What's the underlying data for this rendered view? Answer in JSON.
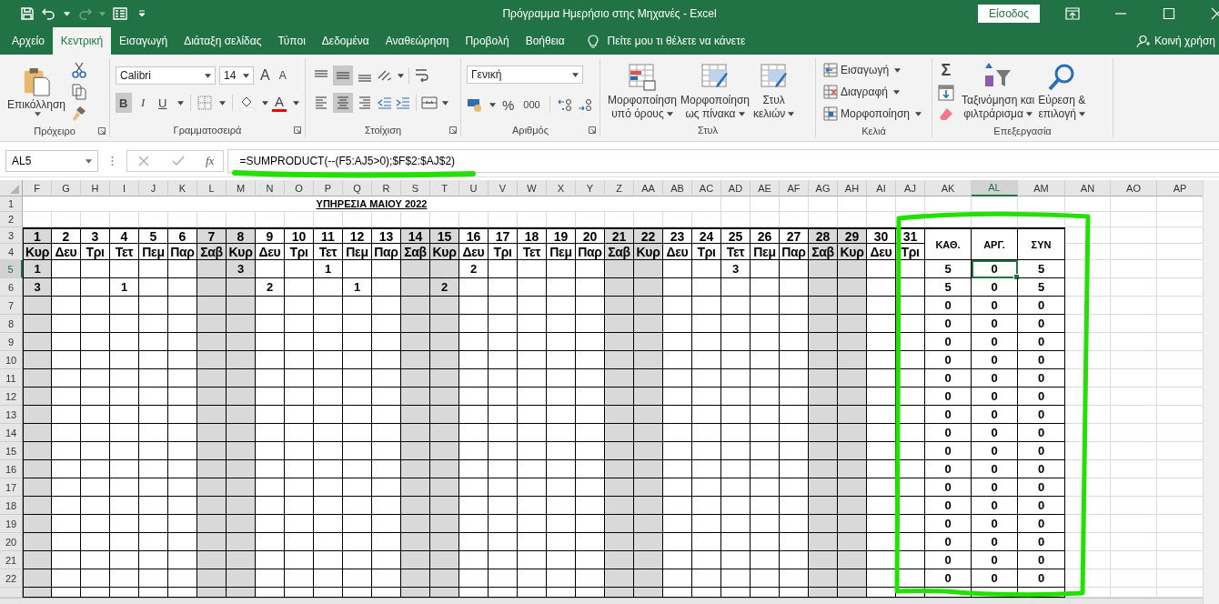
{
  "window": {
    "title": "Πρόγραμμα Ημερήσιο στης Μηχανές  -  Excel",
    "sign_in": "Είσοδος"
  },
  "tabs": [
    {
      "label": "Αρχείο",
      "selected": false
    },
    {
      "label": "Κεντρική",
      "selected": true
    },
    {
      "label": "Εισαγωγή",
      "selected": false
    },
    {
      "label": "Διάταξη σελίδας",
      "selected": false
    },
    {
      "label": "Τύποι",
      "selected": false
    },
    {
      "label": "Δεδομένα",
      "selected": false
    },
    {
      "label": "Αναθεώρηση",
      "selected": false
    },
    {
      "label": "Προβολή",
      "selected": false
    },
    {
      "label": "Βοήθεια",
      "selected": false
    }
  ],
  "tell_me": "Πείτε μου τι θέλετε να κάνετε",
  "share": "Κοινή χρήση",
  "ribbon": {
    "clipboard": {
      "paste": "Επικόλληση",
      "label": "Πρόχειρο"
    },
    "font": {
      "name": "Calibri",
      "size": "14",
      "grow": "A",
      "shrink": "A",
      "color_letter": "A",
      "label": "Γραμματοσειρά",
      "styles": [
        {
          "kind": "bold",
          "label": "B",
          "on": true
        },
        {
          "kind": "italic",
          "label": "I",
          "on": false
        },
        {
          "kind": "underline",
          "label": "U",
          "on": false
        }
      ]
    },
    "alignment": {
      "label": "Στοίχιση",
      "vertical": [
        {
          "kind": "top",
          "selected": false
        },
        {
          "kind": "middle",
          "selected": true
        },
        {
          "kind": "bottom",
          "selected": false
        }
      ],
      "horizontal": [
        {
          "kind": "left",
          "selected": false
        },
        {
          "kind": "center",
          "selected": true
        },
        {
          "kind": "right",
          "selected": false
        }
      ]
    },
    "number": {
      "format": "Γενική",
      "percent": "%",
      "thousands": "000",
      "label": "Αριθμός"
    },
    "styles": {
      "label": "Στυλ",
      "buttons": [
        {
          "lines": [
            "Μορφοποίηση",
            "υπό όρους"
          ]
        },
        {
          "lines": [
            "Μορφοποίηση",
            "ως πίνακα"
          ]
        },
        {
          "lines": [
            "Στυλ",
            "κελιών"
          ]
        }
      ]
    },
    "cells": {
      "label": "Κελιά",
      "buttons": [
        "Εισαγωγή",
        "Διαγραφή",
        "Μορφοποίηση"
      ]
    },
    "editing": {
      "label": "Επεξεργασία",
      "autosum": "Σ",
      "buttons": [
        {
          "lines": [
            "Ταξινόμηση και",
            "φιλτράρισμα"
          ]
        },
        {
          "lines": [
            "Εύρεση &",
            "επιλογή"
          ]
        }
      ]
    }
  },
  "formula_bar": {
    "name_box": "AL5",
    "fx": "fx",
    "formula": "=SUMPRODUCT(--(F5:AJ5>0);$F$2:$AJ$2)"
  },
  "sheet": {
    "columns": [
      {
        "label": "F",
        "selected": false
      },
      {
        "label": "G",
        "selected": false
      },
      {
        "label": "H",
        "selected": false
      },
      {
        "label": "I",
        "selected": false
      },
      {
        "label": "J",
        "selected": false
      },
      {
        "label": "K",
        "selected": false
      },
      {
        "label": "L",
        "selected": false
      },
      {
        "label": "M",
        "selected": false
      },
      {
        "label": "N",
        "selected": false
      },
      {
        "label": "O",
        "selected": false
      },
      {
        "label": "P",
        "selected": false
      },
      {
        "label": "Q",
        "selected": false
      },
      {
        "label": "R",
        "selected": false
      },
      {
        "label": "S",
        "selected": false
      },
      {
        "label": "T",
        "selected": false
      },
      {
        "label": "U",
        "selected": false
      },
      {
        "label": "V",
        "selected": false
      },
      {
        "label": "W",
        "selected": false
      },
      {
        "label": "X",
        "selected": false
      },
      {
        "label": "Y",
        "selected": false
      },
      {
        "label": "Z",
        "selected": false
      },
      {
        "label": "AA",
        "selected": false
      },
      {
        "label": "AB",
        "selected": false
      },
      {
        "label": "AC",
        "selected": false
      },
      {
        "label": "AD",
        "selected": false
      },
      {
        "label": "AE",
        "selected": false
      },
      {
        "label": "AF",
        "selected": false
      },
      {
        "label": "AG",
        "selected": false
      },
      {
        "label": "AH",
        "selected": false
      },
      {
        "label": "AI",
        "selected": false
      },
      {
        "label": "AJ",
        "selected": false
      },
      {
        "label": "AK",
        "selected": false
      },
      {
        "label": "AL",
        "selected": true
      },
      {
        "label": "AM",
        "selected": false
      },
      {
        "label": "AN",
        "selected": false
      },
      {
        "label": "AO",
        "selected": false
      },
      {
        "label": "AP",
        "selected": false
      }
    ],
    "title": "ΥΠΗΡΕΣΙΑ ΜΑΙΟΥ 2022",
    "top_rows": [
      "1",
      "2",
      "3",
      "4"
    ],
    "days": [
      {
        "number": "1",
        "name": "Κυρ",
        "weekend": true
      },
      {
        "number": "2",
        "name": "Δευ",
        "weekend": false
      },
      {
        "number": "3",
        "name": "Τρι",
        "weekend": false
      },
      {
        "number": "4",
        "name": "Τετ",
        "weekend": false
      },
      {
        "number": "5",
        "name": "Πεμ",
        "weekend": false
      },
      {
        "number": "6",
        "name": "Παρ",
        "weekend": false
      },
      {
        "number": "7",
        "name": "Σαβ",
        "weekend": true
      },
      {
        "number": "8",
        "name": "Κυρ",
        "weekend": true
      },
      {
        "number": "9",
        "name": "Δευ",
        "weekend": false
      },
      {
        "number": "10",
        "name": "Τρι",
        "weekend": false
      },
      {
        "number": "11",
        "name": "Τετ",
        "weekend": false
      },
      {
        "number": "12",
        "name": "Πεμ",
        "weekend": false
      },
      {
        "number": "13",
        "name": "Παρ",
        "weekend": false
      },
      {
        "number": "14",
        "name": "Σαβ",
        "weekend": true
      },
      {
        "number": "15",
        "name": "Κυρ",
        "weekend": true
      },
      {
        "number": "16",
        "name": "Δευ",
        "weekend": false
      },
      {
        "number": "17",
        "name": "Τρι",
        "weekend": false
      },
      {
        "number": "18",
        "name": "Τετ",
        "weekend": false
      },
      {
        "number": "19",
        "name": "Πεμ",
        "weekend": false
      },
      {
        "number": "20",
        "name": "Παρ",
        "weekend": false
      },
      {
        "number": "21",
        "name": "Σαβ",
        "weekend": true
      },
      {
        "number": "22",
        "name": "Κυρ",
        "weekend": true
      },
      {
        "number": "23",
        "name": "Δευ",
        "weekend": false
      },
      {
        "number": "24",
        "name": "Τρι",
        "weekend": false
      },
      {
        "number": "25",
        "name": "Τετ",
        "weekend": false
      },
      {
        "number": "26",
        "name": "Πεμ",
        "weekend": false
      },
      {
        "number": "27",
        "name": "Παρ",
        "weekend": false
      },
      {
        "number": "28",
        "name": "Σαβ",
        "weekend": true
      },
      {
        "number": "29",
        "name": "Κυρ",
        "weekend": true
      },
      {
        "number": "30",
        "name": "Δευ",
        "weekend": false
      },
      {
        "number": "31",
        "name": "Τρι",
        "weekend": false
      }
    ],
    "summary_headers": [
      "ΚΑΘ.",
      "ΑΡΓ.",
      "ΣΥΝ"
    ],
    "rows": [
      {
        "number": "5",
        "selected": true,
        "cells": [
          "1",
          null,
          null,
          null,
          null,
          null,
          null,
          "3",
          null,
          null,
          "1",
          null,
          null,
          null,
          null,
          "2",
          null,
          null,
          null,
          null,
          null,
          null,
          null,
          null,
          "3",
          null,
          null,
          null,
          null,
          null,
          null
        ],
        "totals": [
          {
            "value": "5",
            "selected": false
          },
          {
            "value": "0",
            "selected": true
          },
          {
            "value": "5",
            "selected": false
          }
        ]
      },
      {
        "number": "6",
        "selected": false,
        "cells": [
          "3",
          null,
          null,
          "1",
          null,
          null,
          null,
          null,
          "2",
          null,
          null,
          "1",
          null,
          null,
          "2",
          null,
          null,
          null,
          null,
          null,
          null,
          null,
          null,
          null,
          null,
          null,
          null,
          null,
          null,
          null,
          null
        ],
        "totals": [
          {
            "value": "5",
            "selected": false
          },
          {
            "value": "0",
            "selected": false
          },
          {
            "value": "5",
            "selected": false
          }
        ]
      },
      {
        "number": "7",
        "selected": false,
        "cells": [
          null,
          null,
          null,
          null,
          null,
          null,
          null,
          null,
          null,
          null,
          null,
          null,
          null,
          null,
          null,
          null,
          null,
          null,
          null,
          null,
          null,
          null,
          null,
          null,
          null,
          null,
          null,
          null,
          null,
          null,
          null
        ],
        "totals": [
          {
            "value": "0",
            "selected": false
          },
          {
            "value": "0",
            "selected": false
          },
          {
            "value": "0",
            "selected": false
          }
        ]
      },
      {
        "number": "8",
        "selected": false,
        "cells": [
          null,
          null,
          null,
          null,
          null,
          null,
          null,
          null,
          null,
          null,
          null,
          null,
          null,
          null,
          null,
          null,
          null,
          null,
          null,
          null,
          null,
          null,
          null,
          null,
          null,
          null,
          null,
          null,
          null,
          null,
          null
        ],
        "totals": [
          {
            "value": "0",
            "selected": false
          },
          {
            "value": "0",
            "selected": false
          },
          {
            "value": "0",
            "selected": false
          }
        ]
      },
      {
        "number": "9",
        "selected": false,
        "cells": [
          null,
          null,
          null,
          null,
          null,
          null,
          null,
          null,
          null,
          null,
          null,
          null,
          null,
          null,
          null,
          null,
          null,
          null,
          null,
          null,
          null,
          null,
          null,
          null,
          null,
          null,
          null,
          null,
          null,
          null,
          null
        ],
        "totals": [
          {
            "value": "0",
            "selected": false
          },
          {
            "value": "0",
            "selected": false
          },
          {
            "value": "0",
            "selected": false
          }
        ]
      },
      {
        "number": "10",
        "selected": false,
        "cells": [
          null,
          null,
          null,
          null,
          null,
          null,
          null,
          null,
          null,
          null,
          null,
          null,
          null,
          null,
          null,
          null,
          null,
          null,
          null,
          null,
          null,
          null,
          null,
          null,
          null,
          null,
          null,
          null,
          null,
          null,
          null
        ],
        "totals": [
          {
            "value": "0",
            "selected": false
          },
          {
            "value": "0",
            "selected": false
          },
          {
            "value": "0",
            "selected": false
          }
        ]
      },
      {
        "number": "11",
        "selected": false,
        "cells": [
          null,
          null,
          null,
          null,
          null,
          null,
          null,
          null,
          null,
          null,
          null,
          null,
          null,
          null,
          null,
          null,
          null,
          null,
          null,
          null,
          null,
          null,
          null,
          null,
          null,
          null,
          null,
          null,
          null,
          null,
          null
        ],
        "totals": [
          {
            "value": "0",
            "selected": false
          },
          {
            "value": "0",
            "selected": false
          },
          {
            "value": "0",
            "selected": false
          }
        ]
      },
      {
        "number": "12",
        "selected": false,
        "cells": [
          null,
          null,
          null,
          null,
          null,
          null,
          null,
          null,
          null,
          null,
          null,
          null,
          null,
          null,
          null,
          null,
          null,
          null,
          null,
          null,
          null,
          null,
          null,
          null,
          null,
          null,
          null,
          null,
          null,
          null,
          null
        ],
        "totals": [
          {
            "value": "0",
            "selected": false
          },
          {
            "value": "0",
            "selected": false
          },
          {
            "value": "0",
            "selected": false
          }
        ]
      },
      {
        "number": "13",
        "selected": false,
        "cells": [
          null,
          null,
          null,
          null,
          null,
          null,
          null,
          null,
          null,
          null,
          null,
          null,
          null,
          null,
          null,
          null,
          null,
          null,
          null,
          null,
          null,
          null,
          null,
          null,
          null,
          null,
          null,
          null,
          null,
          null,
          null
        ],
        "totals": [
          {
            "value": "0",
            "selected": false
          },
          {
            "value": "0",
            "selected": false
          },
          {
            "value": "0",
            "selected": false
          }
        ]
      },
      {
        "number": "14",
        "selected": false,
        "cells": [
          null,
          null,
          null,
          null,
          null,
          null,
          null,
          null,
          null,
          null,
          null,
          null,
          null,
          null,
          null,
          null,
          null,
          null,
          null,
          null,
          null,
          null,
          null,
          null,
          null,
          null,
          null,
          null,
          null,
          null,
          null
        ],
        "totals": [
          {
            "value": "0",
            "selected": false
          },
          {
            "value": "0",
            "selected": false
          },
          {
            "value": "0",
            "selected": false
          }
        ]
      },
      {
        "number": "15",
        "selected": false,
        "cells": [
          null,
          null,
          null,
          null,
          null,
          null,
          null,
          null,
          null,
          null,
          null,
          null,
          null,
          null,
          null,
          null,
          null,
          null,
          null,
          null,
          null,
          null,
          null,
          null,
          null,
          null,
          null,
          null,
          null,
          null,
          null
        ],
        "totals": [
          {
            "value": "0",
            "selected": false
          },
          {
            "value": "0",
            "selected": false
          },
          {
            "value": "0",
            "selected": false
          }
        ]
      },
      {
        "number": "16",
        "selected": false,
        "cells": [
          null,
          null,
          null,
          null,
          null,
          null,
          null,
          null,
          null,
          null,
          null,
          null,
          null,
          null,
          null,
          null,
          null,
          null,
          null,
          null,
          null,
          null,
          null,
          null,
          null,
          null,
          null,
          null,
          null,
          null,
          null
        ],
        "totals": [
          {
            "value": "0",
            "selected": false
          },
          {
            "value": "0",
            "selected": false
          },
          {
            "value": "0",
            "selected": false
          }
        ]
      },
      {
        "number": "17",
        "selected": false,
        "cells": [
          null,
          null,
          null,
          null,
          null,
          null,
          null,
          null,
          null,
          null,
          null,
          null,
          null,
          null,
          null,
          null,
          null,
          null,
          null,
          null,
          null,
          null,
          null,
          null,
          null,
          null,
          null,
          null,
          null,
          null,
          null
        ],
        "totals": [
          {
            "value": "0",
            "selected": false
          },
          {
            "value": "0",
            "selected": false
          },
          {
            "value": "0",
            "selected": false
          }
        ]
      },
      {
        "number": "18",
        "selected": false,
        "cells": [
          null,
          null,
          null,
          null,
          null,
          null,
          null,
          null,
          null,
          null,
          null,
          null,
          null,
          null,
          null,
          null,
          null,
          null,
          null,
          null,
          null,
          null,
          null,
          null,
          null,
          null,
          null,
          null,
          null,
          null,
          null
        ],
        "totals": [
          {
            "value": "0",
            "selected": false
          },
          {
            "value": "0",
            "selected": false
          },
          {
            "value": "0",
            "selected": false
          }
        ]
      },
      {
        "number": "19",
        "selected": false,
        "cells": [
          null,
          null,
          null,
          null,
          null,
          null,
          null,
          null,
          null,
          null,
          null,
          null,
          null,
          null,
          null,
          null,
          null,
          null,
          null,
          null,
          null,
          null,
          null,
          null,
          null,
          null,
          null,
          null,
          null,
          null,
          null
        ],
        "totals": [
          {
            "value": "0",
            "selected": false
          },
          {
            "value": "0",
            "selected": false
          },
          {
            "value": "0",
            "selected": false
          }
        ]
      },
      {
        "number": "20",
        "selected": false,
        "cells": [
          null,
          null,
          null,
          null,
          null,
          null,
          null,
          null,
          null,
          null,
          null,
          null,
          null,
          null,
          null,
          null,
          null,
          null,
          null,
          null,
          null,
          null,
          null,
          null,
          null,
          null,
          null,
          null,
          null,
          null,
          null
        ],
        "totals": [
          {
            "value": "0",
            "selected": false
          },
          {
            "value": "0",
            "selected": false
          },
          {
            "value": "0",
            "selected": false
          }
        ]
      },
      {
        "number": "21",
        "selected": false,
        "cells": [
          null,
          null,
          null,
          null,
          null,
          null,
          null,
          null,
          null,
          null,
          null,
          null,
          null,
          null,
          null,
          null,
          null,
          null,
          null,
          null,
          null,
          null,
          null,
          null,
          null,
          null,
          null,
          null,
          null,
          null,
          null
        ],
        "totals": [
          {
            "value": "0",
            "selected": false
          },
          {
            "value": "0",
            "selected": false
          },
          {
            "value": "0",
            "selected": false
          }
        ]
      },
      {
        "number": "22",
        "selected": false,
        "cells": [
          null,
          null,
          null,
          null,
          null,
          null,
          null,
          null,
          null,
          null,
          null,
          null,
          null,
          null,
          null,
          null,
          null,
          null,
          null,
          null,
          null,
          null,
          null,
          null,
          null,
          null,
          null,
          null,
          null,
          null,
          null
        ],
        "totals": [
          {
            "value": "0",
            "selected": false
          },
          {
            "value": "0",
            "selected": false
          },
          {
            "value": "0",
            "selected": false
          }
        ]
      }
    ]
  }
}
